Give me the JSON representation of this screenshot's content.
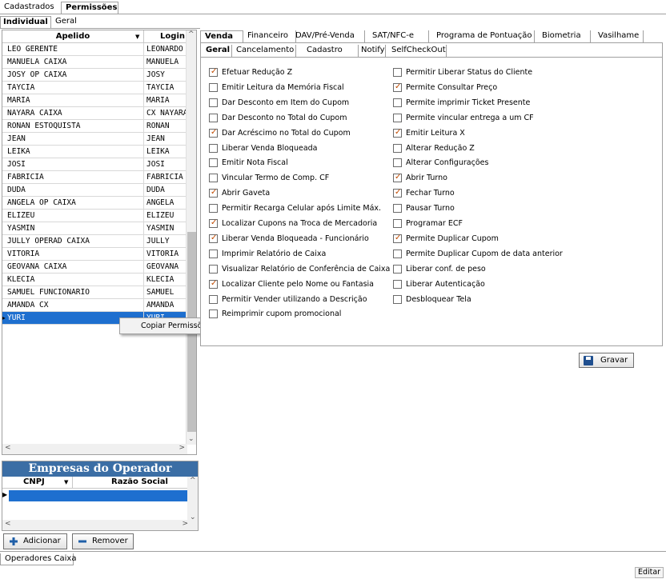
{
  "top_tabs": [
    "Cadastrados",
    "Permissões"
  ],
  "sub_tabs": [
    "Individual",
    "Geral"
  ],
  "grid": {
    "col_apelido": "Apelido",
    "col_login": "Login",
    "rows": [
      {
        "apelido": "LEO GERENTE",
        "login": "LEONARDO"
      },
      {
        "apelido": "MANUELA CAIXA",
        "login": "MANUELA"
      },
      {
        "apelido": "JOSY OP CAIXA",
        "login": "JOSY"
      },
      {
        "apelido": "TAYCIA",
        "login": "TAYCIA"
      },
      {
        "apelido": "MARIA",
        "login": "MARIA"
      },
      {
        "apelido": "NAYARA CAIXA",
        "login": "CX NAYARA"
      },
      {
        "apelido": "RONAN ESTOQUISTA",
        "login": "RONAN"
      },
      {
        "apelido": "JEAN",
        "login": "JEAN"
      },
      {
        "apelido": "LEIKA",
        "login": "LEIKA"
      },
      {
        "apelido": "JOSI",
        "login": "JOSI"
      },
      {
        "apelido": "FABRICIA",
        "login": "FABRICIA"
      },
      {
        "apelido": "DUDA",
        "login": "DUDA"
      },
      {
        "apelido": "ANGELA OP CAIXA",
        "login": "ANGELA"
      },
      {
        "apelido": "ELIZEU",
        "login": "ELIZEU"
      },
      {
        "apelido": "YASMIN",
        "login": "YASMIN"
      },
      {
        "apelido": "JULLY OPERAD CAIXA",
        "login": "JULLY"
      },
      {
        "apelido": "VITORIA",
        "login": "VITORIA"
      },
      {
        "apelido": "GEOVANA CAIXA",
        "login": "GEOVANA"
      },
      {
        "apelido": "KLECIA",
        "login": "KLECIA"
      },
      {
        "apelido": "SAMUEL FUNCIONARIO",
        "login": "SAMUEL"
      },
      {
        "apelido": "AMANDA CX",
        "login": "AMANDA"
      },
      {
        "apelido": "YURI",
        "login": "YURI"
      }
    ],
    "selected_index": 21
  },
  "context_menu": {
    "item": "Copiar Permissões de..."
  },
  "empresas": {
    "title": "Empresas do Operador",
    "col_cnpj": "CNPJ",
    "col_razao": "Razão Social"
  },
  "buttons": {
    "adicionar": "Adicionar",
    "remover": "Remover",
    "gravar": "Gravar",
    "editar": "Editar"
  },
  "right_tabs": [
    "Venda",
    "Financeiro",
    "DAV/Pré-Venda",
    "SAT/NFC-e",
    "Programa de Pontuação",
    "Biometria",
    "Vasilhame"
  ],
  "right_subtabs": [
    "Geral",
    "Cancelamento",
    "Cadastro",
    "Notify",
    "SelfCheckOut"
  ],
  "permissions_left": [
    {
      "label": "Efetuar Redução Z",
      "checked": true
    },
    {
      "label": "Emitir Leitura da Memória Fiscal",
      "checked": false
    },
    {
      "label": "Dar Desconto em Item do Cupom",
      "checked": false
    },
    {
      "label": "Dar Desconto no Total do Cupom",
      "checked": false
    },
    {
      "label": "Dar Acréscimo no Total do Cupom",
      "checked": true
    },
    {
      "label": "Liberar Venda Bloqueada",
      "checked": false
    },
    {
      "label": "Emitir Nota Fiscal",
      "checked": false
    },
    {
      "label": "Vincular Termo de Comp. CF",
      "checked": false
    },
    {
      "label": "Abrir Gaveta",
      "checked": true
    },
    {
      "label": "Permitir Recarga Celular após Limite Máx.",
      "checked": false
    },
    {
      "label": "Localizar Cupons na Troca de Mercadoria",
      "checked": true
    },
    {
      "label": "Liberar Venda Bloqueada - Funcionário",
      "checked": true
    },
    {
      "label": "Imprimir Relatório de Caixa",
      "checked": false
    },
    {
      "label": "Visualizar Relatório de Conferência de Caixa",
      "checked": false
    },
    {
      "label": "Localizar Cliente pelo Nome ou Fantasia",
      "checked": true
    },
    {
      "label": "Permitir Vender utilizando a Descrição",
      "checked": false
    },
    {
      "label": "Reimprimir cupom promocional",
      "checked": false
    }
  ],
  "permissions_right": [
    {
      "label": "Permitir Liberar Status do Cliente",
      "checked": false
    },
    {
      "label": "Permite Consultar Preço",
      "checked": true
    },
    {
      "label": "Permite imprimir Ticket Presente",
      "checked": false
    },
    {
      "label": "Permite vincular entrega a um CF",
      "checked": false
    },
    {
      "label": "Emitir Leitura X",
      "checked": true
    },
    {
      "label": "Alterar Redução Z",
      "checked": false
    },
    {
      "label": "Alterar Configurações",
      "checked": false
    },
    {
      "label": "Abrir Turno",
      "checked": true
    },
    {
      "label": "Fechar Turno",
      "checked": true
    },
    {
      "label": "Pausar Turno",
      "checked": false
    },
    {
      "label": "Programar ECF",
      "checked": false
    },
    {
      "label": "Permite Duplicar Cupom",
      "checked": true
    },
    {
      "label": "Permite Duplicar Cupom de data anterior",
      "checked": false
    },
    {
      "label": "Liberar conf. de peso",
      "checked": false
    },
    {
      "label": "Liberar Autenticação",
      "checked": false
    },
    {
      "label": "Desbloquear Tela",
      "checked": false
    }
  ],
  "bottom_tab": "Operadores Caixa"
}
